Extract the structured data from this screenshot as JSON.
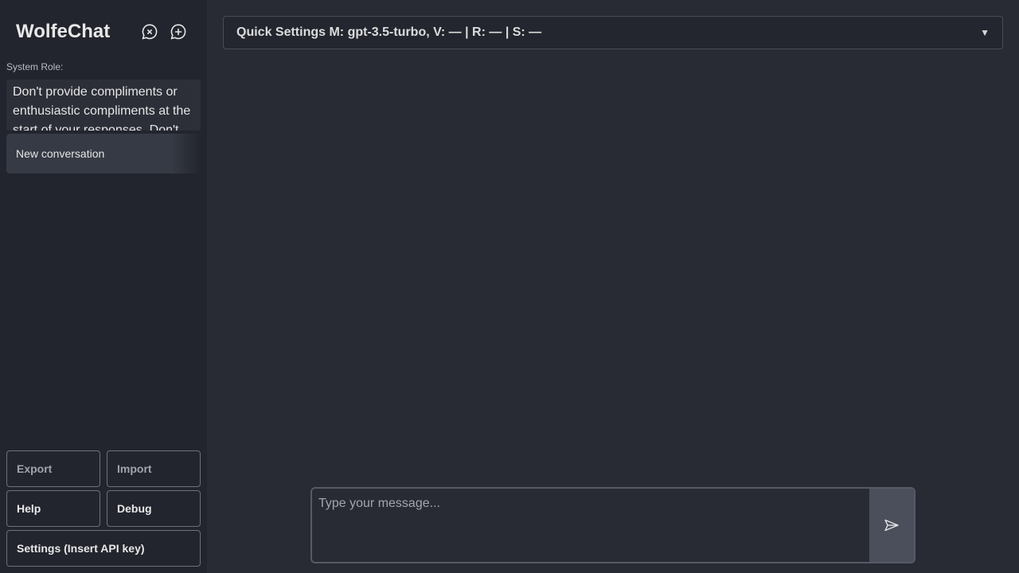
{
  "app": {
    "title": "WolfeChat"
  },
  "header_icons": [
    {
      "name": "clear-conversation-icon"
    },
    {
      "name": "new-conversation-icon"
    }
  ],
  "system_role": {
    "label": "System Role:",
    "value": "Don't provide compliments or enthusiastic compliments at the start of your responses. Don't"
  },
  "conversations": [
    {
      "title": "New conversation"
    }
  ],
  "sidebar_buttons": {
    "export": "Export",
    "import": "Import",
    "help": "Help",
    "debug": "Debug",
    "settings": "Settings (Insert API key)"
  },
  "quick_settings": {
    "label": "Quick Settings M: gpt-3.5-turbo, V: — | R: — | S: —",
    "caret": "▼"
  },
  "composer": {
    "placeholder": "Type your message...",
    "send_icon": "send-icon"
  },
  "colors": {
    "main_bg": "#282b34",
    "sidebar_bg": "#22252d",
    "send_button_bg": "#4a4f5b"
  }
}
